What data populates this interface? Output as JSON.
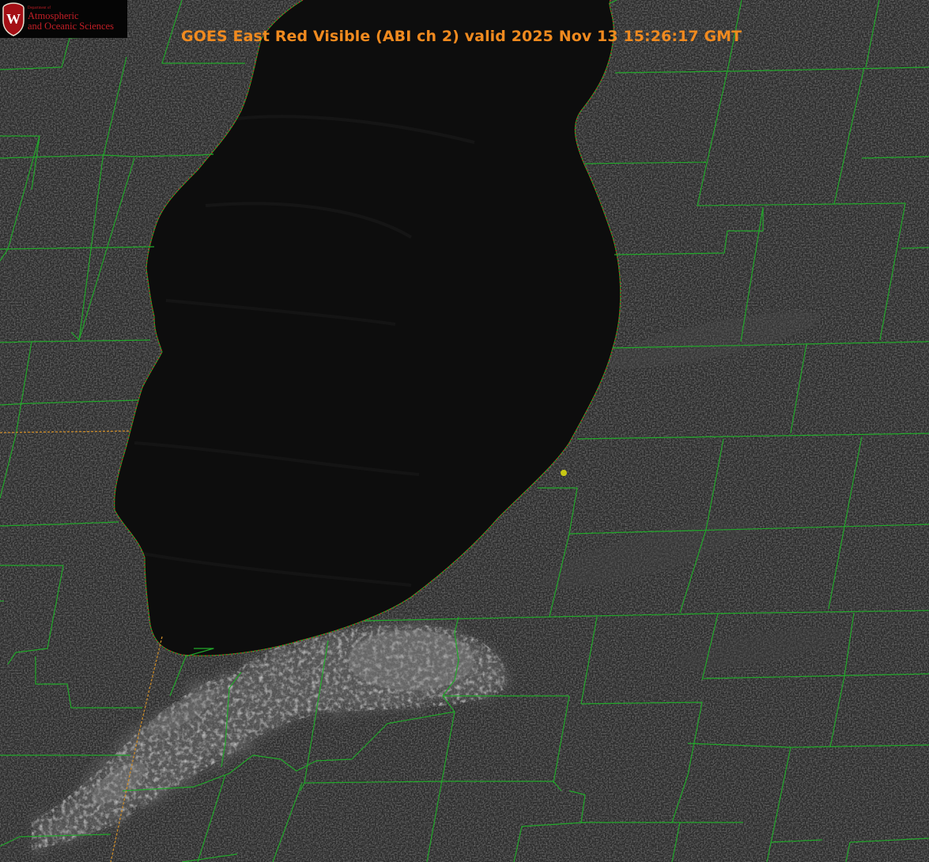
{
  "title": "GOES East Red Visible (ABI ch 2) valid 2025 Nov 13 15:26:17 GMT",
  "logo": {
    "department": "Department of",
    "line1": "Atmospheric",
    "line2": "and Oceanic Sciences",
    "crest_letter": "W"
  },
  "colors": {
    "title": "#f08a1f",
    "county_lines": "#22a82a",
    "state_line": "#c98a2a",
    "shoreline_dots": "#d42020",
    "marker": "#c8c814",
    "crest": "#a40f15",
    "logo_text": "#c41e26"
  },
  "map": {
    "feature": "lake",
    "marker_icon": "location-dot-icon"
  }
}
